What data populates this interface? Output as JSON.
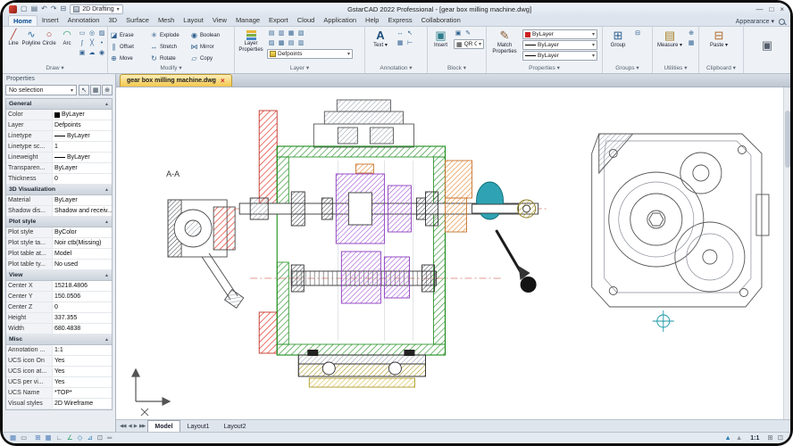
{
  "titlebar": {
    "workspace": "2D Drafting",
    "title": "GstarCAD 2022 Professional - [gear box milling machine.dwg]",
    "quick_icons": [
      {
        "name": "new-file-icon",
        "glyph": "▢"
      },
      {
        "name": "save-icon",
        "glyph": "▤"
      },
      {
        "name": "undo-icon",
        "glyph": "↶"
      },
      {
        "name": "redo-icon",
        "glyph": "↷"
      },
      {
        "name": "print-icon",
        "glyph": "⊟"
      }
    ],
    "window_buttons": {
      "minimize": "—",
      "maximize": "□",
      "close": "×"
    }
  },
  "ribbon_tabs": {
    "active_index": 0,
    "items": [
      "Home",
      "Insert",
      "Annotation",
      "3D",
      "Surface",
      "Mesh",
      "Layout",
      "View",
      "Manage",
      "Export",
      "Cloud",
      "Application",
      "Help",
      "Express",
      "Collaboration"
    ],
    "appearance_label": "Appearance"
  },
  "ribbon": {
    "draw": {
      "label": "Draw",
      "tools": [
        {
          "name": "line-tool",
          "label": "Line",
          "glyph": "╱",
          "color": "#b03a2e"
        },
        {
          "name": "polyline-tool",
          "label": "Polyline",
          "glyph": "∿",
          "color": "#2e6da4"
        },
        {
          "name": "circle-tool",
          "label": "Circle",
          "glyph": "○",
          "color": "#b03a2e"
        },
        {
          "name": "arc-tool",
          "label": "Arc",
          "glyph": "◠",
          "color": "#2f9e66"
        }
      ],
      "extra_icons": [
        {
          "name": "rectangle-icon",
          "glyph": "▭"
        },
        {
          "name": "ellipse-icon",
          "glyph": "◎"
        },
        {
          "name": "hatch-icon",
          "glyph": "▨"
        },
        {
          "name": "spline-icon",
          "glyph": "∫"
        },
        {
          "name": "construction-line-icon",
          "glyph": "╳"
        },
        {
          "name": "point-icon",
          "glyph": "•"
        },
        {
          "name": "region-icon",
          "glyph": "▣"
        },
        {
          "name": "revision-cloud-icon",
          "glyph": "☁"
        },
        {
          "name": "donut-icon",
          "glyph": "◉"
        }
      ]
    },
    "modify": {
      "label": "Modify",
      "items": [
        {
          "name": "erase-tool",
          "label": "Erase",
          "glyph": "◪"
        },
        {
          "name": "explode-tool",
          "label": "Explode",
          "glyph": "✳"
        },
        {
          "name": "boolean-tool",
          "label": "Boolean",
          "glyph": "◉"
        },
        {
          "name": "offset-tool",
          "label": "Offset",
          "glyph": "∥"
        },
        {
          "name": "stretch-tool",
          "label": "Stretch",
          "glyph": "↔"
        },
        {
          "name": "mirror-tool",
          "label": "Mirror",
          "glyph": "⋈"
        },
        {
          "name": "move-tool",
          "label": "Move",
          "glyph": "⊕"
        },
        {
          "name": "rotate-tool",
          "label": "Rotate",
          "glyph": "↻"
        },
        {
          "name": "copy-tool",
          "label": "Copy",
          "glyph": "▱"
        }
      ]
    },
    "layer": {
      "label": "Layer",
      "properties_line1": "Layer",
      "properties_line2": "Properties",
      "dropdown_value": "Defpoints",
      "icons": [
        {
          "name": "layer-on-icon",
          "glyph": "▤"
        },
        {
          "name": "layer-freeze-icon",
          "glyph": "▥"
        },
        {
          "name": "layer-lock-icon",
          "glyph": "▦"
        },
        {
          "name": "layer-color-icon",
          "glyph": "▧"
        },
        {
          "name": "layer-isolate-icon",
          "glyph": "▨"
        },
        {
          "name": "layer-off-icon",
          "glyph": "▩"
        },
        {
          "name": "layer-match-icon",
          "glyph": "▤"
        },
        {
          "name": "layer-previous-icon",
          "glyph": "▥"
        }
      ]
    },
    "annotation": {
      "label": "Annotation",
      "text_button": "Text",
      "icons": [
        {
          "name": "linear-dimension-icon",
          "glyph": "↔"
        },
        {
          "name": "leader-icon",
          "glyph": "↖"
        },
        {
          "name": "table-icon",
          "glyph": "▦"
        },
        {
          "name": "dimension-style-icon",
          "glyph": "⊢"
        }
      ]
    },
    "block": {
      "label": "Block",
      "insert_button": "Insert",
      "qr_label": "QR Code",
      "icons": [
        {
          "name": "create-block-icon",
          "glyph": "▣"
        },
        {
          "name": "edit-block-icon",
          "glyph": "✎"
        }
      ]
    },
    "properties": {
      "label": "Properties",
      "match_line1": "Match",
      "match_line2": "Properties",
      "dropdowns": [
        {
          "name": "color-control",
          "value": "ByLayer",
          "swatch_color": "#cc2222"
        },
        {
          "name": "linetype-control",
          "value": "ByLayer",
          "swatch_line": true
        },
        {
          "name": "lineweight-control",
          "value": "ByLayer",
          "swatch_line": true
        }
      ]
    },
    "groups": {
      "label": "Groups",
      "group_button": "Group",
      "icons": [
        {
          "name": "ungroup-icon",
          "glyph": "⊟"
        }
      ]
    },
    "utilities": {
      "label": "Utilities",
      "measure_button": "Measure",
      "icons": [
        {
          "name": "id-point-icon",
          "glyph": "⊕"
        },
        {
          "name": "quick-calc-icon",
          "glyph": "▦"
        }
      ]
    },
    "clipboard": {
      "label": "Clipboard",
      "paste_button": "Paste"
    }
  },
  "document_tab": {
    "title": "gear box milling machine.dwg",
    "close": "×"
  },
  "properties_panel": {
    "title": "Properties",
    "selector_value": "No selection",
    "selector_buttons": [
      {
        "name": "select-objects-icon",
        "glyph": "↖"
      },
      {
        "name": "quick-select-icon",
        "glyph": "▦"
      },
      {
        "name": "toggle-pickadd-icon",
        "glyph": "⊕"
      }
    ],
    "sections": [
      {
        "header": "General",
        "rows": [
          {
            "label": "Color",
            "value": "ByLayer",
            "swatch": "color"
          },
          {
            "label": "Layer",
            "value": "Defpoints"
          },
          {
            "label": "Linetype",
            "value": "ByLayer",
            "swatch": "line"
          },
          {
            "label": "Linetype sc...",
            "value": "1"
          },
          {
            "label": "Lineweight",
            "value": "ByLayer",
            "swatch": "line"
          },
          {
            "label": "Transparen...",
            "value": "ByLayer"
          },
          {
            "label": "Thickness",
            "value": "0"
          }
        ]
      },
      {
        "header": "3D Visualization",
        "rows": [
          {
            "label": "Material",
            "value": "ByLayer"
          },
          {
            "label": "Shadow dis...",
            "value": "Shadow and receiv..."
          }
        ]
      },
      {
        "header": "Plot style",
        "rows": [
          {
            "label": "Plot style",
            "value": "ByColor"
          },
          {
            "label": "Plot style ta...",
            "value": "Noir ctb(Missing)"
          },
          {
            "label": "Plot table at...",
            "value": "Model"
          },
          {
            "label": "Plot table ty...",
            "value": "No used"
          }
        ]
      },
      {
        "header": "View",
        "rows": [
          {
            "label": "Center X",
            "value": "15218.4806"
          },
          {
            "label": "Center Y",
            "value": "150.0506"
          },
          {
            "label": "Center Z",
            "value": "0"
          },
          {
            "label": "Height",
            "value": "337.355"
          },
          {
            "label": "Width",
            "value": "680.4838"
          }
        ]
      },
      {
        "header": "Misc",
        "rows": [
          {
            "label": "Annotation ...",
            "value": "1:1"
          },
          {
            "label": "UCS icon On",
            "value": "Yes"
          },
          {
            "label": "UCS icon at...",
            "value": "Yes"
          },
          {
            "label": "UCS per vi...",
            "value": "Yes"
          },
          {
            "label": "UCS Name",
            "value": "*TOP*"
          },
          {
            "label": "Visual styles",
            "value": "2D Wireframe"
          }
        ]
      }
    ]
  },
  "drawing": {
    "section_label": "A-A"
  },
  "layout_tabs": {
    "nav": [
      "◀◀",
      "◀",
      "▶",
      "▶▶"
    ],
    "items": [
      {
        "label": "Model",
        "active": true
      },
      {
        "label": "Layout1",
        "active": false
      },
      {
        "label": "Layout2",
        "active": false
      }
    ]
  },
  "statusbar": {
    "scale_label": "1:1",
    "left_icons": [
      {
        "name": "model-space-icon",
        "glyph": "▦",
        "color": "#4a7ab5"
      },
      {
        "name": "paper-space-icon",
        "glyph": "▭",
        "color": "#66707c"
      }
    ],
    "center_icons": [
      {
        "name": "snap-icon",
        "glyph": "⊞",
        "color": "#4a7ab5"
      },
      {
        "name": "grid-icon",
        "glyph": "▦",
        "color": "#4a7ab5"
      },
      {
        "name": "ortho-icon",
        "glyph": "∟",
        "color": "#66707c"
      },
      {
        "name": "polar-icon",
        "glyph": "∠",
        "color": "#2f9e66"
      },
      {
        "name": "osnap-icon",
        "glyph": "◇",
        "color": "#2a7fb5"
      },
      {
        "name": "otrack-icon",
        "glyph": "⊿",
        "color": "#2a7fb5"
      },
      {
        "name": "dynamic-input-icon",
        "glyph": "⊡",
        "color": "#66707c"
      },
      {
        "name": "lineweight-icon",
        "glyph": "═",
        "color": "#66707c"
      }
    ],
    "right_icons": [
      {
        "name": "annotation-visibility-icon",
        "glyph": "▲",
        "color": "#2a7fb5"
      },
      {
        "name": "annotation-autoscale-icon",
        "glyph": "▲",
        "color": "#8a94a0"
      }
    ],
    "far_icons": [
      {
        "name": "workspace-switch-icon",
        "glyph": "⊞",
        "color": "#66707c"
      },
      {
        "name": "clean-screen-icon",
        "glyph": "⊡",
        "color": "#66707c"
      }
    ]
  }
}
